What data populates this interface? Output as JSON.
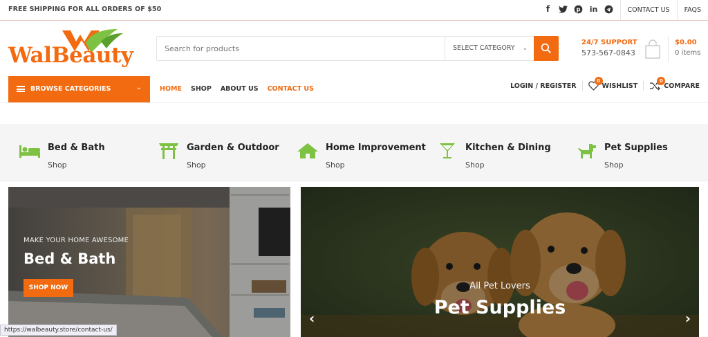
{
  "topbar": {
    "shipping_text": "FREE SHIPPING FOR ALL ORDERS OF $50",
    "social_icons": [
      "facebook-icon",
      "twitter-icon",
      "pinterest-icon",
      "linkedin-icon",
      "telegram-icon"
    ],
    "links": [
      "CONTACT US",
      "FAQS"
    ]
  },
  "header": {
    "logo_text": "WalBeauty",
    "search_placeholder": "Search for products",
    "category_select": "SELECT CATEGORY",
    "support_label": "24/7 SUPPORT",
    "support_phone": "573-567-0843",
    "cart_amount": "$0.00",
    "cart_items": "0 items"
  },
  "nav": {
    "browse_label": "BROWSE CATEGORIES",
    "items": [
      {
        "label": "HOME",
        "active": true
      },
      {
        "label": "SHOP",
        "active": false
      },
      {
        "label": "ABOUT US",
        "active": false
      },
      {
        "label": "CONTACT US",
        "active": true
      }
    ],
    "login": "LOGIN / REGISTER",
    "wishlist": "WISHLIST",
    "wishlist_count": "0",
    "compare": "COMPARE",
    "compare_count": "0"
  },
  "categories": [
    {
      "name": "Bed & Bath",
      "link": "Shop",
      "icon": "bed-icon"
    },
    {
      "name": "Garden & Outdoor",
      "link": "Shop",
      "icon": "torii-gate-icon"
    },
    {
      "name": "Home Improvement",
      "link": "Shop",
      "icon": "house-icon"
    },
    {
      "name": "Kitchen & Dining",
      "link": "Shop",
      "icon": "cocktail-glass-icon"
    },
    {
      "name": "Pet Supplies",
      "link": "Shop",
      "icon": "dog-icon"
    }
  ],
  "banners": {
    "left": {
      "kicker": "MAKE YOUR HOME AWESOME",
      "title": "Bed & Bath",
      "button": "SHOP NOW"
    },
    "right": {
      "kicker": "All Pet Lovers",
      "title": "Pet Supplies"
    }
  },
  "status_url": "https://walbeauty.store/contact-us/",
  "colors": {
    "accent": "#f26b11",
    "icon_green": "#7dc242"
  }
}
